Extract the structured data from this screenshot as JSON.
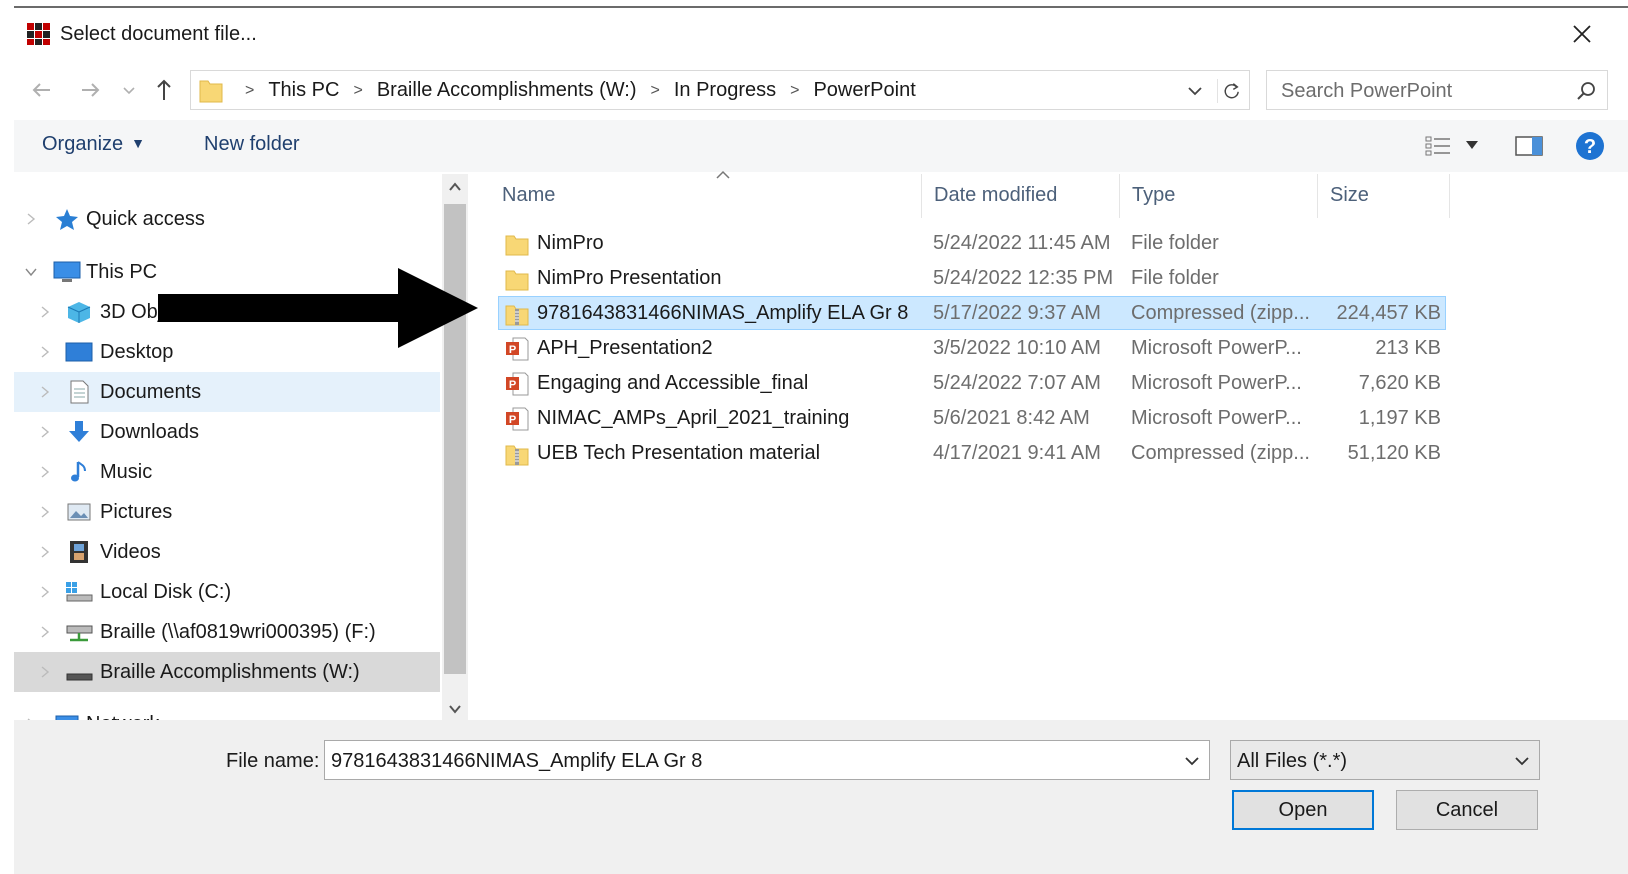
{
  "window": {
    "title": "Select document file..."
  },
  "address": {
    "crumbs": [
      "This PC",
      "Braille Accomplishments (W:)",
      "In Progress",
      "PowerPoint"
    ]
  },
  "search": {
    "placeholder": "Search PowerPoint"
  },
  "toolbar": {
    "organize_label": "Organize",
    "new_folder_label": "New folder"
  },
  "nav": {
    "items": [
      {
        "label": "Quick access",
        "icon": "star-icon"
      },
      {
        "label": "This PC",
        "icon": "computer-icon"
      },
      {
        "label": "3D Obj",
        "icon": "cube-icon"
      },
      {
        "label": "Desktop",
        "icon": "desktop-icon"
      },
      {
        "label": "Documents",
        "icon": "document-icon"
      },
      {
        "label": "Downloads",
        "icon": "download-arrow-icon"
      },
      {
        "label": "Music",
        "icon": "music-note-icon"
      },
      {
        "label": "Pictures",
        "icon": "picture-icon"
      },
      {
        "label": "Videos",
        "icon": "film-icon"
      },
      {
        "label": "Local Disk (C:)",
        "icon": "local-disk-icon"
      },
      {
        "label": "Braille (\\\\af0819wri000395) (F:)",
        "icon": "network-drive-icon"
      },
      {
        "label": "Braille Accomplishments (W:)",
        "icon": "drive-icon"
      },
      {
        "label": "Network",
        "icon": "network-icon"
      }
    ]
  },
  "columns": {
    "name": "Name",
    "date": "Date modified",
    "type": "Type",
    "size": "Size"
  },
  "files": [
    {
      "name": "NimPro",
      "date": "5/24/2022 11:45 AM",
      "type": "File folder",
      "size": "",
      "icon": "folder-icon"
    },
    {
      "name": "NimPro Presentation",
      "date": "5/24/2022 12:35 PM",
      "type": "File folder",
      "size": "",
      "icon": "folder-icon"
    },
    {
      "name": "9781643831466NIMAS_Amplify ELA Gr 8",
      "date": "5/17/2022 9:37 AM",
      "type": "Compressed (zipp...",
      "size": "224,457 KB",
      "icon": "zip-folder-icon"
    },
    {
      "name": "APH_Presentation2",
      "date": "3/5/2022 10:10 AM",
      "type": "Microsoft PowerP...",
      "size": "213 KB",
      "icon": "powerpoint-file-icon"
    },
    {
      "name": "Engaging and Accessible_final",
      "date": "5/24/2022 7:07 AM",
      "type": "Microsoft PowerP...",
      "size": "7,620 KB",
      "icon": "powerpoint-file-icon"
    },
    {
      "name": "NIMAC_AMPs_April_2021_training",
      "date": "5/6/2021 8:42 AM",
      "type": "Microsoft PowerP...",
      "size": "1,197 KB",
      "icon": "powerpoint-file-icon"
    },
    {
      "name": "UEB Tech Presentation material",
      "date": "4/17/2021 9:41 AM",
      "type": "Compressed (zipp...",
      "size": "51,120 KB",
      "icon": "zip-folder-icon"
    }
  ],
  "footer": {
    "file_name_label": "File name:",
    "file_name_value": "9781643831466NIMAS_Amplify ELA Gr 8",
    "filter_value": "All Files (*.*)",
    "open_label": "Open",
    "cancel_label": "Cancel"
  },
  "colors": {
    "selection_bg": "#cce8ff",
    "selection_border": "#99d1ff",
    "link_text": "#1f3f6e",
    "accent": "#0078d7"
  }
}
